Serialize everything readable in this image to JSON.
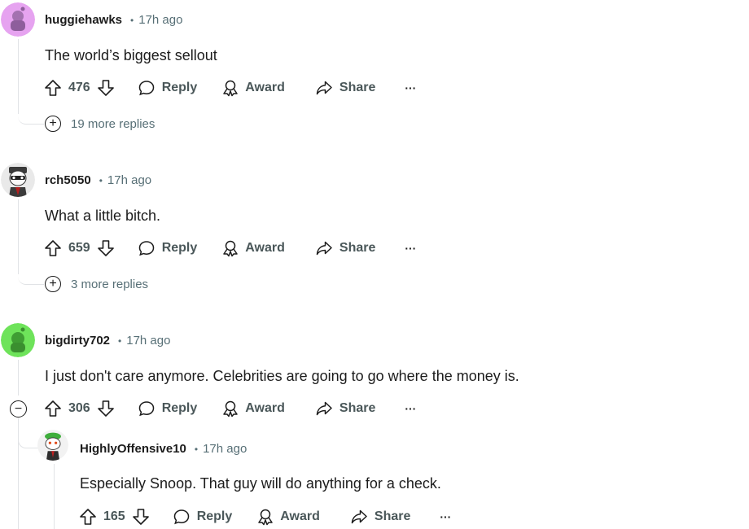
{
  "comments": [
    {
      "username": "huggiehawks",
      "time": "17h ago",
      "text": "The world’s biggest sellout",
      "votes": "476",
      "reply_label": "Reply",
      "award_label": "Award",
      "share_label": "Share",
      "more_replies": "19 more replies",
      "avatar_color": "#e6a3f0"
    },
    {
      "username": "rch5050",
      "time": "17h ago",
      "text": "What a little bitch.",
      "votes": "659",
      "reply_label": "Reply",
      "award_label": "Award",
      "share_label": "Share",
      "more_replies": "3 more replies",
      "avatar_color": "#e9e9e9"
    },
    {
      "username": "bigdirty702",
      "time": "17h ago",
      "text": "I just don't care anymore. Celebrities are going to go where the money is.",
      "votes": "306",
      "reply_label": "Reply",
      "award_label": "Award",
      "share_label": "Share",
      "avatar_color": "#6ee35a"
    },
    {
      "username": "HighlyOffensive10",
      "time": "17h ago",
      "text": "Especially Snoop. That guy will do anything for a check.",
      "votes": "165",
      "reply_label": "Reply",
      "award_label": "Award",
      "share_label": "Share",
      "avatar_color": "#f2f2f2"
    }
  ],
  "separator": "•",
  "overflow_glyph": "···",
  "expand_glyph": "+",
  "collapse_glyph": "−"
}
